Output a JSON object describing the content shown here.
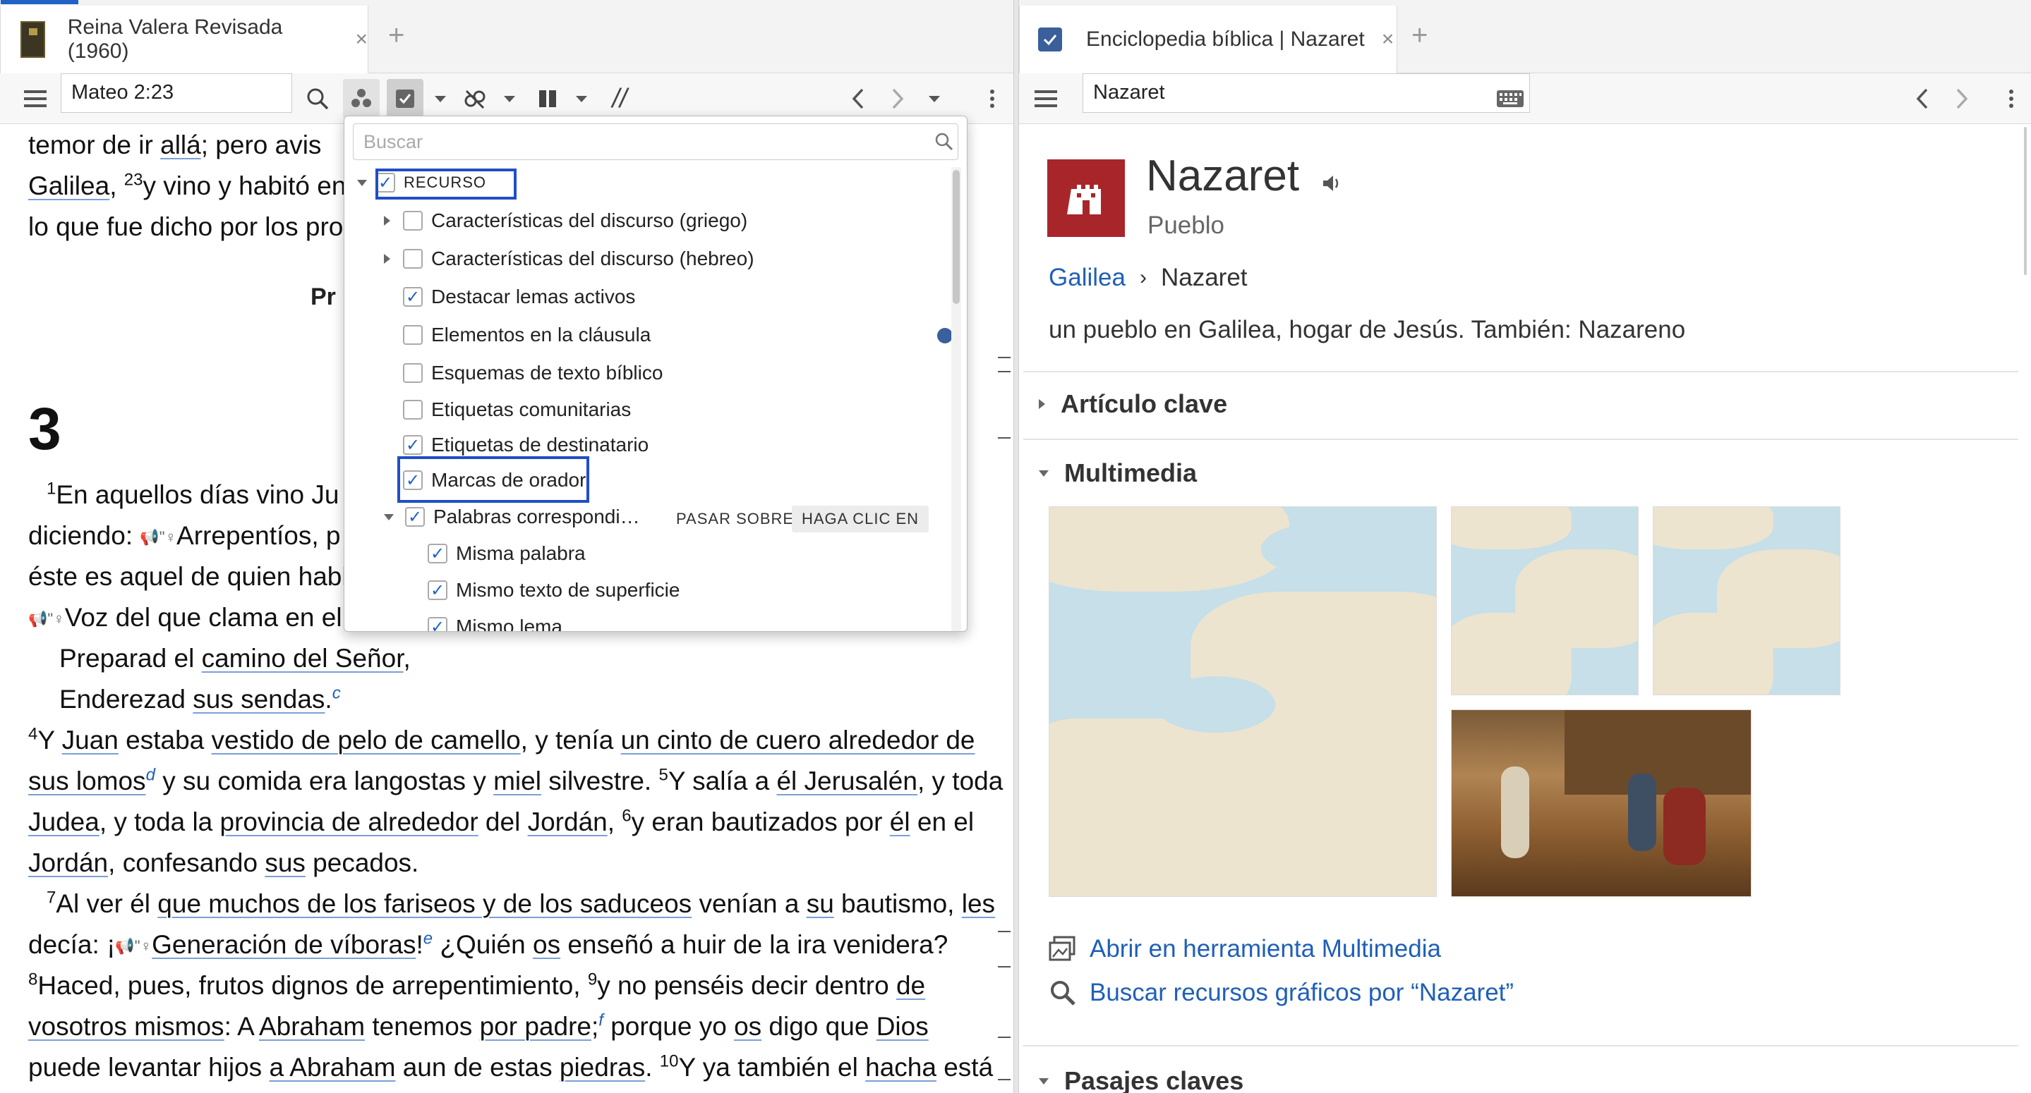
{
  "left_pane": {
    "tab": {
      "title": "Reina Valera Revisada (1960)",
      "close": "×",
      "add": "+"
    },
    "toolbar": {
      "reference": "Mateo 2:23",
      "parallel_glyph": "//"
    },
    "heading_partial": "Pr",
    "chapter": "3",
    "lines": {
      "l1a": "temor de ir",
      "l1b": "allá",
      "l1c": "; pero avis",
      "l2a": "Galilea",
      "l2b": ", ",
      "l2sup": "23",
      "l2c": "y vino y habitó en",
      "l3": "lo que fue dicho por los prof",
      "l4sup": "1",
      "l4": "En aquellos días vino Ju",
      "l5a": "diciendo: ",
      "l5b": "Arrepentíos, p",
      "l6": "éste es aquel de quien habl",
      "l7": "Voz del que clama en el",
      "l8a": "Preparad el ",
      "l8b": "camino del Señor",
      "l8c": ",",
      "l9a": "Enderezad ",
      "l9b": "sus sendas",
      "l9c": ".",
      "l9fn": "c",
      "l10sup": "4",
      "l10a": "Y ",
      "l10b": "Juan",
      "l10c": " estaba ",
      "l10d": "vestido de pelo de camello",
      "l10e": ", y tenía ",
      "l10f": "un cinto de cuero",
      "l10g": " alrededor de",
      "l11a": "sus lomos",
      "l11fn": "d",
      "l11b": " y su comida era langostas y ",
      "l11c": "miel",
      "l11d": " silvestre. ",
      "l11sup": "5",
      "l11e": "Y salía a ",
      "l11f": "él Jerusalén",
      "l11g": ", y toda",
      "l12a": "Judea",
      "l12b": ", y toda la ",
      "l12c": "provincia de alrededor",
      "l12d": " del ",
      "l12e": "Jordán",
      "l12f": ", ",
      "l12sup": "6",
      "l12g": "y eran bautizados por ",
      "l12h": "él",
      "l12i": " en el",
      "l13a": "Jordán",
      "l13b": ", confesando ",
      "l13c": "sus",
      "l13d": " pecados.",
      "l14sup": "7",
      "l14a": "Al ver él ",
      "l14b": "que muchos de los fariseos y de los saduceos",
      "l14c": " venían a ",
      "l14d": "su",
      "l14e": " bautismo, ",
      "l14f": "les",
      "l15a": "decía: ¡",
      "l15b": "Generación de víboras",
      "l15c": "!",
      "l15fn": "e",
      "l15d": " ¿Quién ",
      "l15e": "os",
      "l15f": " enseñó a huir de la ira venidera?",
      "l16sup": "8",
      "l16a": "Haced, pues, frutos dignos de arrepentimiento, ",
      "l16sup2": "9",
      "l16b": "y no penséis decir dentro ",
      "l16c": "de",
      "l17a": "vosotros mismos",
      "l17b": ": A ",
      "l17c": "Abraham",
      "l17d": " tenemos ",
      "l17e": "por padre",
      "l17f": ";",
      "l17fn": "f",
      "l17g": " porque yo ",
      "l17h": "os",
      "l17i": " digo que ",
      "l17j": "Dios",
      "l18a": "puede levantar hijos ",
      "l18b": "a Abraham",
      "l18c": " aun de estas ",
      "l18d": "piedras",
      "l18e": ". ",
      "l18sup": "10",
      "l18f": "Y ya también el ",
      "l18g": "hacha",
      "l18h": " está"
    }
  },
  "dropdown": {
    "search_placeholder": "Buscar",
    "root_label": "RECURSO",
    "items": [
      {
        "label": "Características del discurso (griego)",
        "checked": false,
        "expandable": true
      },
      {
        "label": "Características del discurso (hebreo)",
        "checked": false,
        "expandable": true
      },
      {
        "label": "Destacar lemas activos",
        "checked": true
      },
      {
        "label": "Elementos en la cláusula",
        "checked": false
      },
      {
        "label": "Esquemas de texto bíblico",
        "checked": false
      },
      {
        "label": "Etiquetas comunitarias",
        "checked": false
      },
      {
        "label": "Etiquetas de destinatario",
        "checked": true
      },
      {
        "label": "Marcas de orador",
        "checked": true
      },
      {
        "label": "Palabras correspondi…",
        "checked": true,
        "expanded": true
      },
      {
        "label": "Misma palabra",
        "checked": true
      },
      {
        "label": "Mismo texto de superficie",
        "checked": true
      },
      {
        "label": "Mismo lema",
        "checked": true
      }
    ],
    "hover_button": "PASAR SOBRE",
    "click_button": "HAGA CLIC EN"
  },
  "right_pane": {
    "tab": {
      "title": "Enciclopedia bíblica | Nazaret",
      "close": "×",
      "add": "+"
    },
    "search_value": "Nazaret",
    "title": "Nazaret",
    "subtitle": "Pueblo",
    "breadcrumb": {
      "parent": "Galilea",
      "separator": "›",
      "current": "Nazaret"
    },
    "description": "un pueblo en Galilea, hogar de Jesús. También: Nazareno",
    "sections": {
      "key_article": "Artículo clave",
      "multimedia": "Multimedia",
      "key_passages": "Pasajes claves"
    },
    "links": {
      "open_multimedia": "Abrir en herramienta Multimedia",
      "search_graphics": "Buscar recursos gráficos por “Nazaret”"
    }
  },
  "colors": {
    "accent": "#1f63c6",
    "link": "#1f5fb8",
    "brand_red": "#a8262a",
    "highlight_box": "#1f4fc6"
  }
}
